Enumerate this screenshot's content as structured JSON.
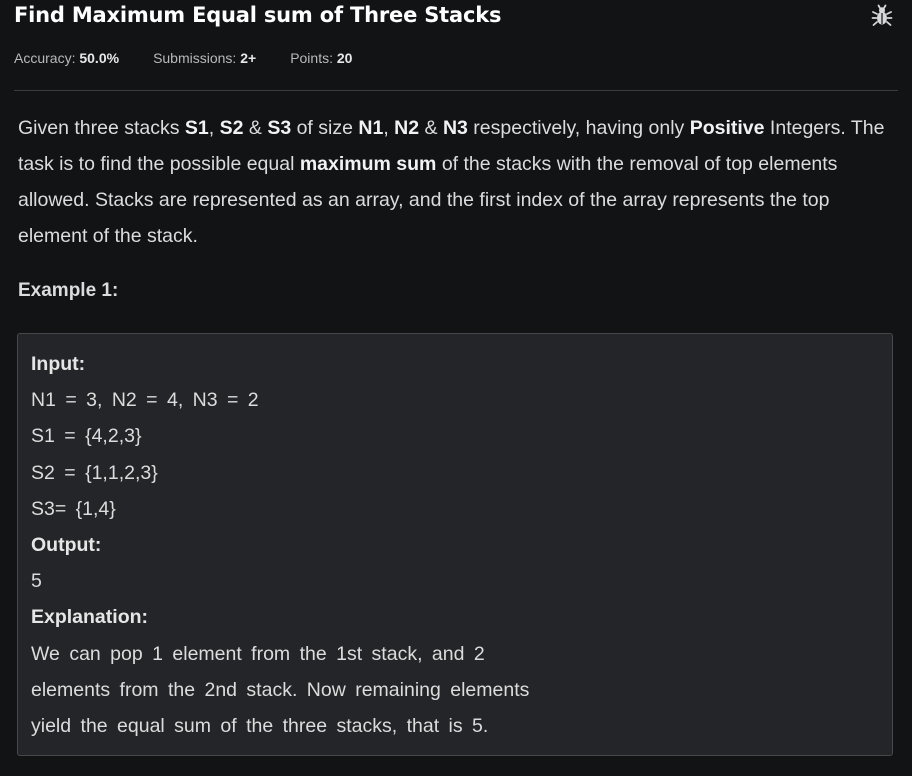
{
  "problem": {
    "title": "Find Maximum Equal sum of Three Stacks",
    "report_icon": "bug-icon"
  },
  "meta": {
    "accuracy_label": "Accuracy:",
    "accuracy_value": "50.0%",
    "submissions_label": "Submissions:",
    "submissions_value": "2+",
    "points_label": "Points:",
    "points_value": "20"
  },
  "description": {
    "t1": "Given three stacks ",
    "s1": "S1",
    "t2": ", ",
    "s2": "S2",
    "t3": " & ",
    "s3": "S3",
    "t4": " of size ",
    "n1": "N1",
    "t5": ", ",
    "n2": "N2",
    "t6": " & ",
    "n3": "N3",
    "t7": " respectively, having only ",
    "positive": "Positive",
    "t8": " Integers. The task is to find the possible equal ",
    "max_sum": "maximum sum",
    "t9": " of the stacks with the removal of top elements allowed. Stacks are represented as an array, and the first index of the array represents the top element of the stack."
  },
  "example": {
    "title": "Example 1:",
    "input_label": "Input:",
    "input_lines": [
      "N1 = 3, N2 = 4, N3 = 2",
      "S1 = {4,2,3}",
      "S2 = {1,1,2,3}",
      "S3= {1,4}"
    ],
    "output_label": "Output:",
    "output_value": "5",
    "explanation_label": "Explanation:",
    "explanation_lines": [
      "We can pop 1 element from the 1st stack, and 2",
      "elements from the 2nd stack. Now remaining elements",
      "yield the equal sum of the three stacks, that is 5."
    ]
  }
}
